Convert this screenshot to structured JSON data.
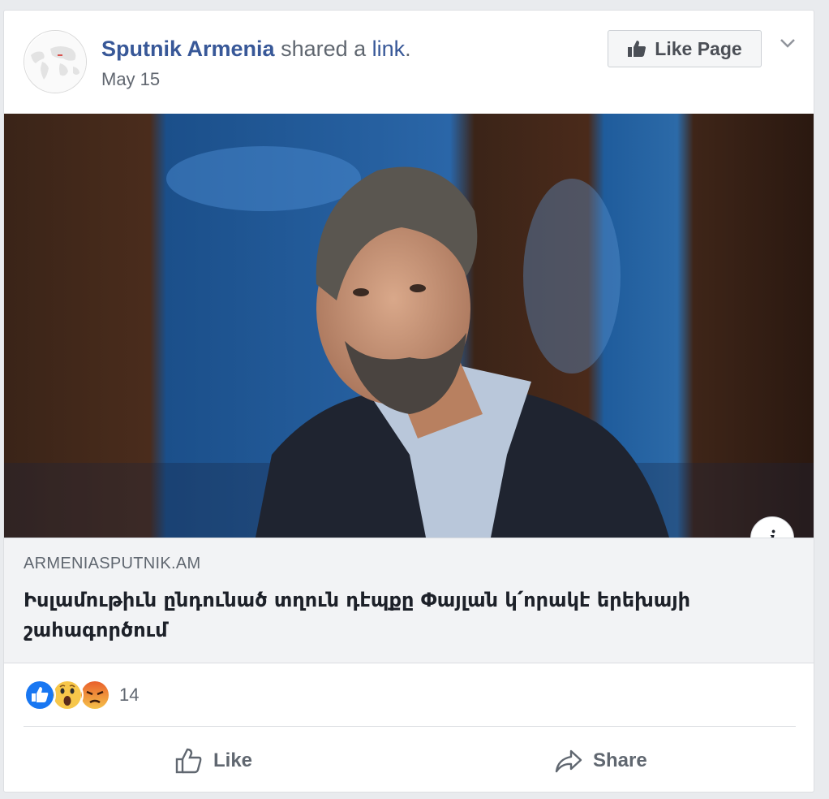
{
  "post": {
    "page_name": "Sputnik Armenia",
    "shared_text": "shared a",
    "link_text": "link",
    "period": ".",
    "date": "May 15",
    "like_page_label": "Like Page"
  },
  "link_preview": {
    "domain": "ARMENIASPUTNIK.AM",
    "headline": "Իսլամութիւն ընդունած տղուն դէպքը Փայլան կ՛որակէ երեխայի շահագործում",
    "info_label": "i"
  },
  "reactions": {
    "types": [
      "like",
      "wow",
      "angry"
    ],
    "count": "14"
  },
  "actions": {
    "like_label": "Like",
    "share_label": "Share"
  },
  "colors": {
    "link_blue": "#385898",
    "text_dark": "#1d2129",
    "text_gray": "#606770",
    "preview_bg": "#f2f3f5"
  }
}
